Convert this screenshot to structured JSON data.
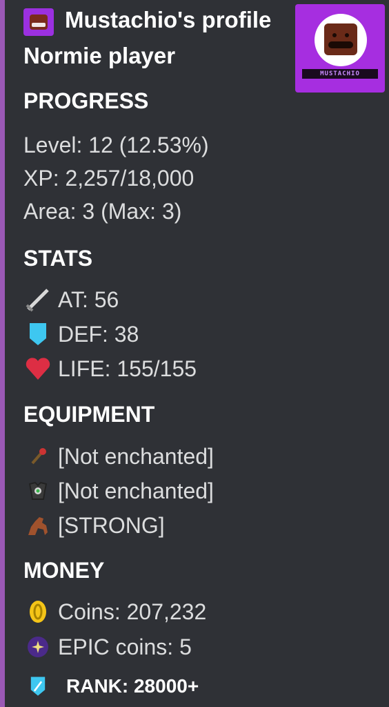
{
  "author": {
    "name": "Mustachio's profile"
  },
  "subtitle": "Normie player",
  "thumbnail": {
    "banner_text": "MUSTACHIO"
  },
  "colors": {
    "accent_bar": "#9b59b6",
    "background": "#2f3136"
  },
  "progress": {
    "title": "PROGRESS",
    "level": "Level: 12 (12.53%)",
    "xp": "XP: 2,257/18,000",
    "area": "Area: 3 (Max: 3)"
  },
  "stats": {
    "title": "STATS",
    "items": [
      {
        "icon": "sword-icon",
        "text": "AT: 56"
      },
      {
        "icon": "shield-icon",
        "text": "DEF: 38"
      },
      {
        "icon": "heart-icon",
        "text": "LIFE: 155/155"
      }
    ]
  },
  "equipment": {
    "title": "EQUIPMENT",
    "items": [
      {
        "icon": "weapon-icon",
        "text": "[Not enchanted]"
      },
      {
        "icon": "armor-icon",
        "text": "[Not enchanted]"
      },
      {
        "icon": "horse-icon",
        "text": "[STRONG]"
      }
    ]
  },
  "money": {
    "title": "MONEY",
    "items": [
      {
        "icon": "coin-icon",
        "text": "Coins: 207,232"
      },
      {
        "icon": "epic-coin-icon",
        "text": "EPIC coins: 5"
      },
      {
        "icon": "rank-icon",
        "text": "RANK: 28000+"
      }
    ]
  }
}
